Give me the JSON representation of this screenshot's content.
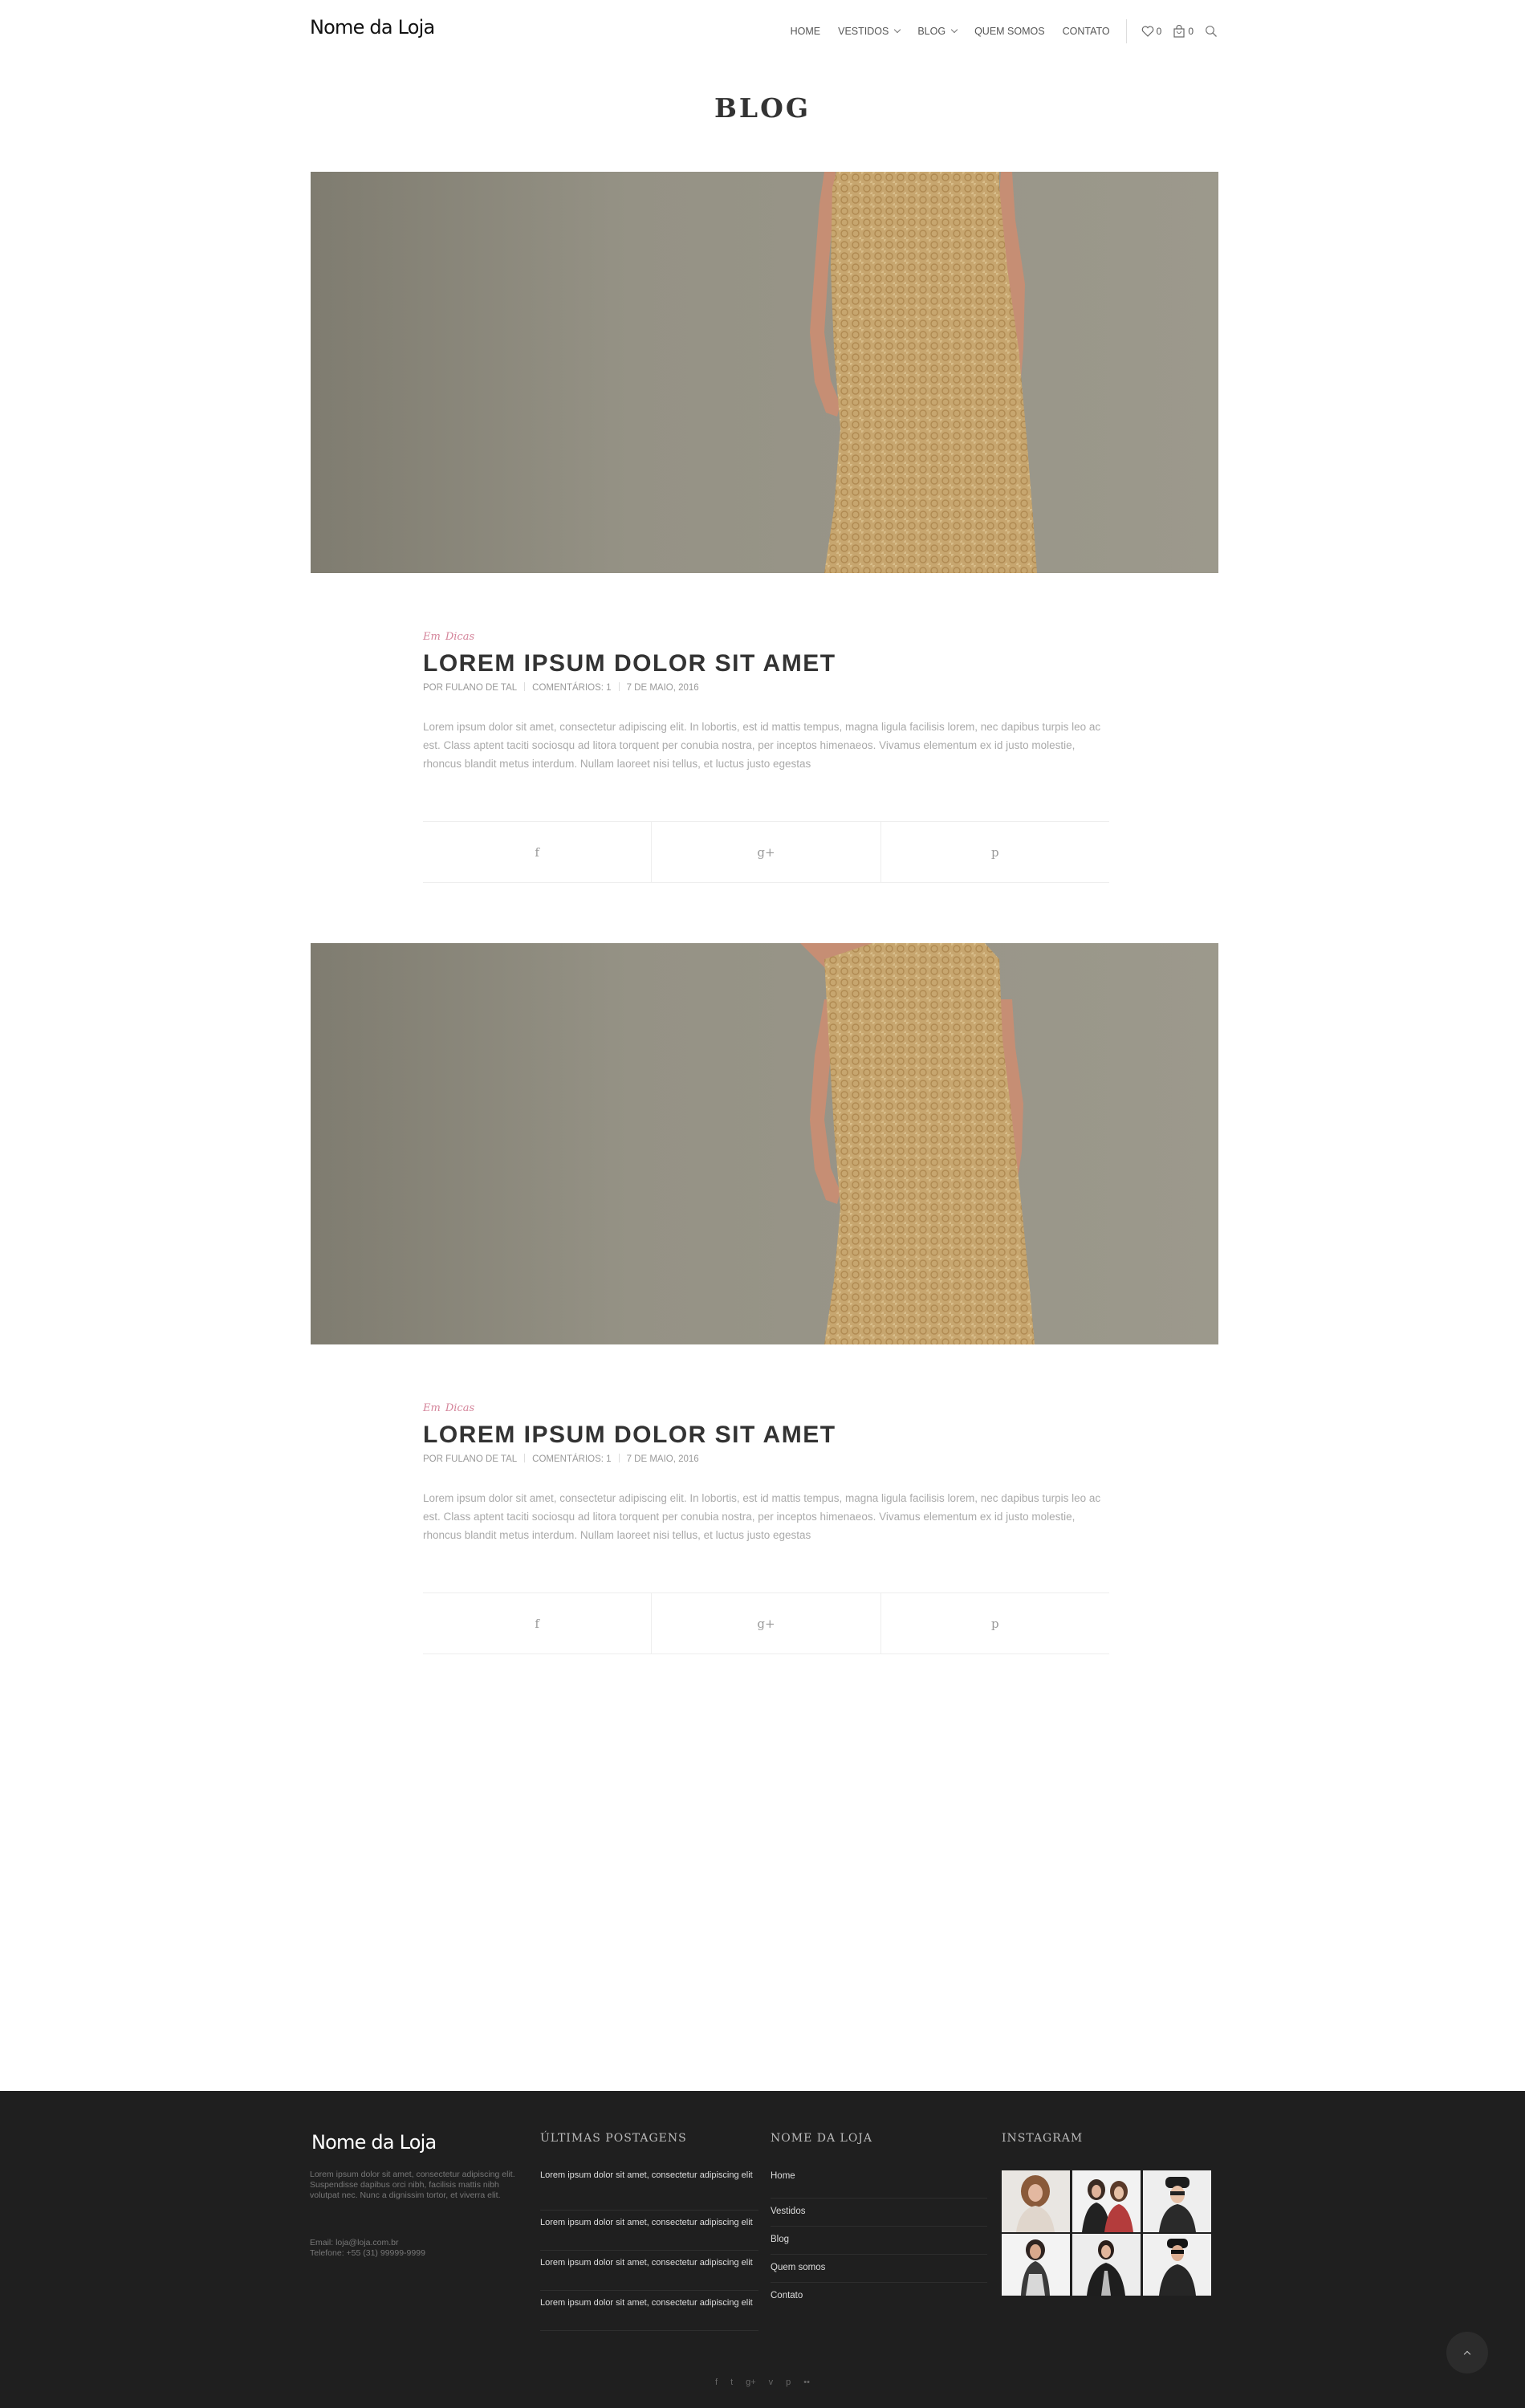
{
  "header": {
    "logo": "Nome da Loja",
    "nav": [
      "HOME",
      "VESTIDOS",
      "BLOG",
      "QUEM SOMOS",
      "CONTATO"
    ],
    "wishlist_count": "0",
    "cart_count": "0",
    "icons": [
      "heart-icon",
      "bag-icon",
      "search-icon",
      "chevron-down-icon"
    ]
  },
  "page_title": "BLOG",
  "posts": [
    {
      "category_prefix": "Em",
      "category": "Dicas",
      "title": "LOREM IPSUM DOLOR SIT AMET",
      "author": "POR FULANO DE TAL",
      "comments": "COMENTÁRIOS: 1",
      "date": "7 DE MAIO, 2016",
      "excerpt": "Lorem ipsum dolor sit amet, consectetur adipiscing elit. In lobortis, est id mattis tempus, magna ligula facilisis lorem, nec dapibus turpis leo ac est. Class aptent taciti sociosqu ad litora torquent per conubia nostra, per inceptos himenaeos. Vivamus elementum ex id justo molestie, rhoncus blandit metus interdum. Nullam laoreet nisi tellus, et luctus justo egestas"
    },
    {
      "category_prefix": "Em",
      "category": "Dicas",
      "title": "LOREM IPSUM DOLOR SIT AMET",
      "author": "POR FULANO DE TAL",
      "comments": "COMENTÁRIOS: 1",
      "date": "7 DE MAIO, 2016",
      "excerpt": "Lorem ipsum dolor sit amet, consectetur adipiscing elit. In lobortis, est id mattis tempus, magna ligula facilisis lorem, nec dapibus turpis leo ac est. Class aptent taciti sociosqu ad litora torquent per conubia nostra, per inceptos himenaeos. Vivamus elementum ex id justo molestie, rhoncus blandit metus interdum. Nullam laoreet nisi tellus, et luctus justo egestas"
    }
  ],
  "share": {
    "facebook": "f",
    "googleplus": "g+",
    "pinterest": "p"
  },
  "footer": {
    "logo": "Nome da Loja",
    "about": "Lorem ipsum dolor sit amet, consectetur adipiscing elit. Suspendisse dapibus orci nibh, facilisis mattis nibh volutpat nec. Nunc a dignissim tortor, et viverra elit.",
    "email": "Email: loja@loja.com.br",
    "phone": "Telefone: +55 (31) 99999-9999",
    "recent_heading": "ÚLTIMAS POSTAGENS",
    "recent_posts": [
      "Lorem ipsum dolor sit amet, consectetur adipiscing elit",
      "Lorem ipsum dolor sit amet, consectetur adipiscing elit",
      "Lorem ipsum dolor sit amet, consectetur adipiscing elit",
      "Lorem ipsum dolor sit amet, consectetur adipiscing elit"
    ],
    "links_heading": "NOME DA LOJA",
    "links": [
      "Home",
      "Vestidos",
      "Blog",
      "Quem somos",
      "Contato"
    ],
    "instagram_heading": "INSTAGRAM",
    "social": [
      "f",
      "t",
      "g+",
      "v",
      "p",
      "••"
    ]
  },
  "colors": {
    "accent": "#d4849a",
    "footer_bg": "#1f1f1f",
    "photo_bg": "#9a978a",
    "dress": "#c8a46c"
  }
}
